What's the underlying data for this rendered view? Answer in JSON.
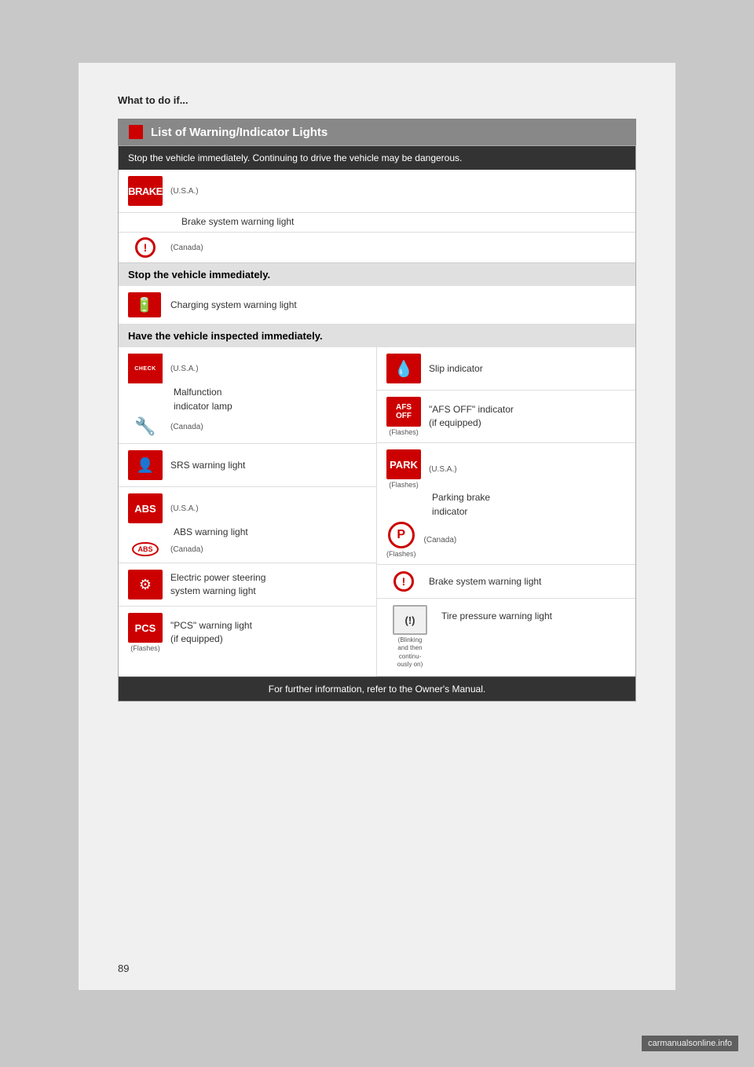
{
  "page": {
    "number": "89",
    "title": "What to do if...",
    "section_header": "List of Warning/Indicator Lights"
  },
  "table": {
    "stop_immediately_header": "Stop the vehicle immediately. Continuing to drive the vehicle may be dangerous.",
    "stop_vehicle_header": "Stop the vehicle immediately.",
    "inspect_header": "Have the vehicle inspected immediately.",
    "footer": "For further information, refer to the Owner's Manual."
  },
  "warnings": {
    "brake_usa_label": "(U.S.A.)",
    "brake_canada_label": "(Canada)",
    "brake_text": "Brake system warning light",
    "brake_icon_text": "BRAKE",
    "charging_text": "Charging system warning light",
    "malfunction_usa": "(U.S.A.)",
    "malfunction_canada": "(Canada)",
    "malfunction_line1": "Malfunction",
    "malfunction_line2": "indicator lamp",
    "check_label": "CHECK",
    "srs_text": "SRS warning light",
    "abs_usa": "(U.S.A.)",
    "abs_text": "ABS warning light",
    "abs_canada": "(Canada)",
    "abs_icon_text": "ABS",
    "abs_icon_outline": "(ABS)",
    "eps_line1": "Electric power steering",
    "eps_line2": "system warning light",
    "pcs_text": "\"PCS\" warning light",
    "pcs_equipped": "(if equipped)",
    "pcs_flashes": "(Flashes)",
    "pcs_icon": "PCS",
    "slip_text": "Slip indicator",
    "afs_line1": "\"AFS OFF\" indicator",
    "afs_line2": "(if equipped)",
    "afs_flashes": "(Flashes)",
    "park_usa": "(U.S.A.)",
    "park_line1": "Parking brake",
    "park_line2": "indicator",
    "park_canada": "(Canada)",
    "park_flashes": "(Flashes)",
    "brake2_text": "Brake system warning light",
    "tire_line1": "Tire pressure warning light",
    "tire_blinking": "(Blinking",
    "tire_and_then": "and then",
    "tire_continu": "continu-",
    "tire_ously_on": "ously on)"
  },
  "watermark": "carmanualsonline.info"
}
